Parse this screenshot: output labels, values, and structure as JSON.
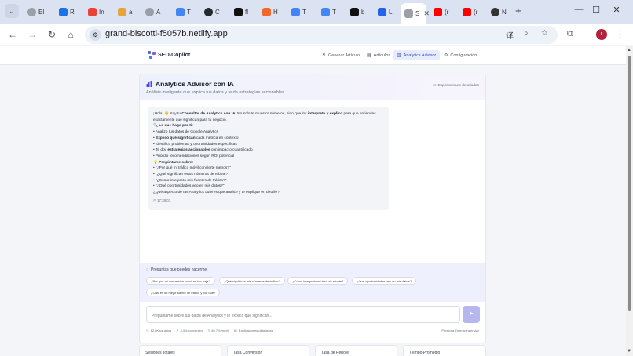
{
  "browser": {
    "tabs": [
      {
        "label": "El",
        "fav": "#9aa0a6",
        "round": true
      },
      {
        "label": "R",
        "fav": "#1a73e8",
        "round": false
      },
      {
        "label": "In",
        "fav": "#ea4335",
        "round": false
      },
      {
        "label": "a",
        "fav": "#e8a33a",
        "round": false
      },
      {
        "label": "A",
        "fav": "#9aa0a6",
        "round": true
      },
      {
        "label": "T",
        "fav": "#4285f4",
        "round": false
      },
      {
        "label": "C",
        "fav": "#24292f",
        "round": true
      },
      {
        "label": "fl",
        "fav": "#111111",
        "round": false
      },
      {
        "label": "H",
        "fav": "#f2672a",
        "round": false
      },
      {
        "label": "T",
        "fav": "#4285f4",
        "round": false
      },
      {
        "label": "T",
        "fav": "#4285f4",
        "round": false
      },
      {
        "label": "b",
        "fav": "#111111",
        "round": false
      },
      {
        "label": "L",
        "fav": "#2563eb",
        "round": false
      },
      {
        "label": "(r",
        "fav": "#ff0000",
        "round": false
      },
      {
        "label": "(r",
        "fav": "#ff0000",
        "round": false
      },
      {
        "label": "N",
        "fav": "#333333",
        "round": true
      }
    ],
    "active_tab": {
      "label": "S",
      "close": "✕"
    },
    "url": "grand-biscotti-f5057b.netlify.app",
    "profile_initial": "r"
  },
  "app": {
    "brand": "SEO-Copilot",
    "nav": [
      {
        "label": "Generar Artículo",
        "icon": "↯",
        "active": false
      },
      {
        "label": "Artículos",
        "icon": "▤",
        "active": false
      },
      {
        "label": "Analytics Advisor",
        "icon": "▥",
        "active": true
      },
      {
        "label": "Configuración",
        "icon": "⚙",
        "active": false
      }
    ]
  },
  "advisor": {
    "title": "Analytics Advisor con IA",
    "subtitle": "Análisis inteligente que explica tus datos y te da estrategias accionables",
    "details_link": "Explicaciones detalladas",
    "message": {
      "greeting_pre": "¡Hola! 👋 Soy tu ",
      "greeting_bold": "Consultor de Analytics con IA",
      "greeting_mid": ". No solo te muestro números, sino que los ",
      "greeting_bold2": "interpreto y explico",
      "greeting_post": " para que entiendas exactamente qué significan para tu negocio.",
      "what_heading": "🔍 Lo que hago por ti:",
      "items": [
        {
          "pre": "• Analizo tus datos de Google Analytics",
          "bold": "",
          "post": ""
        },
        {
          "pre": "• ",
          "bold": "Explico qué significan",
          "post": " cada métrica en contexto"
        },
        {
          "pre": "• Identifico problemas y oportunidades específicas",
          "bold": "",
          "post": ""
        },
        {
          "pre": "• Te doy ",
          "bold": "estrategias accionables",
          "post": " con impacto cuantificado"
        },
        {
          "pre": "• Priorizo recomendaciones según ROI potencial",
          "bold": "",
          "post": ""
        }
      ],
      "ask_heading": "💡 Pregúntame sobre:",
      "questions": [
        "• \"¿Por qué mi tráfico móvil convierte menos?\"",
        "• \"¿Qué significan estos números de rebote?\"",
        "• \"¿Cómo interpreto mis fuentes de tráfico?\"",
        "• \"¿Qué oportunidades veo en mis datos?\""
      ],
      "closing": "¿Qué aspecto de tus Analytics quieres que analice y te explique en detalle?",
      "time": "17:38:03"
    },
    "suggest_title": "Preguntas que puedes hacerme:",
    "chips": [
      "¿Por qué mi conversión móvil es tan baja?",
      "¿Qué significan mis números de tráfico?",
      "¿Cómo interpreto mi tasa de rebote?",
      "¿Qué oportunidades veo en mis datos?",
      "¿Cuál es mi mejor fuente de tráfico y por qué?"
    ],
    "input_placeholder": "Pregúntame sobre tus datos de Analytics y te explico qué significan...",
    "meta": [
      {
        "icon": "⚇",
        "text": "12.8K usuarios"
      },
      {
        "icon": "↗",
        "text": "3.4% conversión"
      },
      {
        "icon": "▯",
        "text": "40.7% móvil"
      },
      {
        "icon": "▤",
        "text": "Explicaciones detalladas"
      }
    ],
    "enter_hint": "Presiona Enter para enviar"
  },
  "stats": [
    "Sesiones Totales",
    "Tasa Conversión",
    "Tasa de Rebote",
    "Tiempo Promedio"
  ]
}
